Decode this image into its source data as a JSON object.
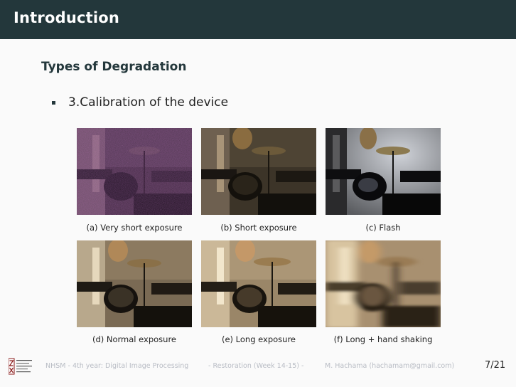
{
  "header": {
    "title": "Introduction"
  },
  "section": {
    "subtitle": "Types of Degradation"
  },
  "bullet": {
    "text": "3.Calibration of the device"
  },
  "figures": [
    {
      "caption": "(a) Very short exposure",
      "tone": "very-dark-noisy"
    },
    {
      "caption": "(b) Short exposure",
      "tone": "dark"
    },
    {
      "caption": "(c) Flash",
      "tone": "flash"
    },
    {
      "caption": "(d) Normal exposure",
      "tone": "normal"
    },
    {
      "caption": "(e) Long exposure",
      "tone": "bright"
    },
    {
      "caption": "(f) Long + hand shaking",
      "tone": "blurred"
    }
  ],
  "footer": {
    "logo_icon": "university-logo-icon",
    "course": "NHSM - 4th year: Digital Image Processing",
    "week": "- Restoration (Week 14-15) -",
    "author": "M. Hachama (hachamam@gmail.com)",
    "page": "7/21"
  }
}
